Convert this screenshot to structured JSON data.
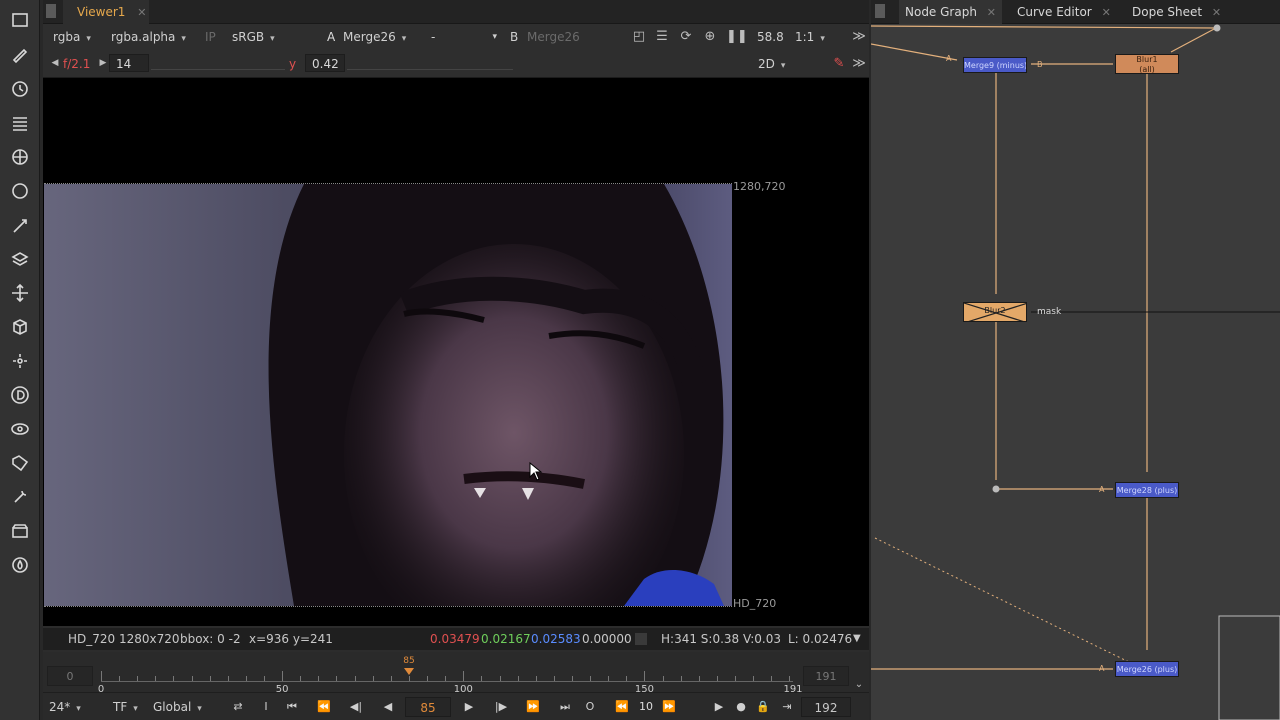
{
  "toolbar": {
    "tools": [
      "image-icon",
      "draw-icon",
      "time-icon",
      "channel-icon",
      "color-icon",
      "filter-icon",
      "keyer-icon",
      "merge-icon",
      "transform-icon",
      "3d-icon",
      "particles-icon",
      "deep-icon",
      "views-icon",
      "metadata-icon",
      "toolsets-icon",
      "other-icon",
      "furnace-icon"
    ]
  },
  "viewer": {
    "tab_label": "Viewer1",
    "close_glyph": "✕",
    "channels": "rgba",
    "alpha_channel": "rgba.alpha",
    "ip_label": "IP",
    "colorspace": "sRGB",
    "input_a_label": "A",
    "input_a_node": "Merge26",
    "operation": "-",
    "input_b_label": "B",
    "input_b_node": "Merge26",
    "zoom_percent": "58.8",
    "zoom_ratio": "1:1",
    "fstop": "f/2.1",
    "frame_step": "14",
    "gamma_label": "y",
    "gamma_value": "0.42",
    "view_mode": "2D",
    "format_corner": "1280,720",
    "format_name": "HD_720"
  },
  "infobar": {
    "format": "HD_720 1280x720",
    "bbox": "bbox: 0 -2",
    "coords": "x=936 y=241",
    "r": "0.03479",
    "g": "0.02167",
    "b": "0.02583",
    "a": "0.00000",
    "hsv": "H:341 S:0.38 V:0.03",
    "luma": "L: 0.02476"
  },
  "timeline": {
    "in_frame": "0",
    "out_frame": "191",
    "current_frame": 85,
    "range_start": 0,
    "range_end": 191,
    "tick_labels": [
      "0",
      "50",
      "100",
      "150",
      "191"
    ]
  },
  "transport": {
    "fps": "24*",
    "timecode_mode": "TF",
    "range_mode": "Global",
    "in_label": "I",
    "current_frame": "85",
    "out_label": "O",
    "skip_increment": "10",
    "end_frame": "192"
  },
  "node_graph": {
    "tabs": [
      "Node Graph",
      "Curve Editor",
      "Dope Sheet"
    ],
    "nodes": {
      "merge_minus": "Merge9 (minus)",
      "blur": "Blur1",
      "blur_sub": "(all)",
      "disabled_node": "Blur2",
      "merge_plus_1": "Merge28 (plus)",
      "merge_plus_2": "Merge26 (plus)"
    },
    "mask_label": "mask",
    "input_a": "A",
    "input_b": "B"
  },
  "colors": {
    "accent_orange": "#e08a3a",
    "merge_node": "#4a5ac8",
    "blur_node": "#d08a5a",
    "edge": "#e3b07c",
    "pixel_red": "#e05050",
    "pixel_green": "#6fce5b",
    "pixel_blue": "#5a8cff"
  }
}
